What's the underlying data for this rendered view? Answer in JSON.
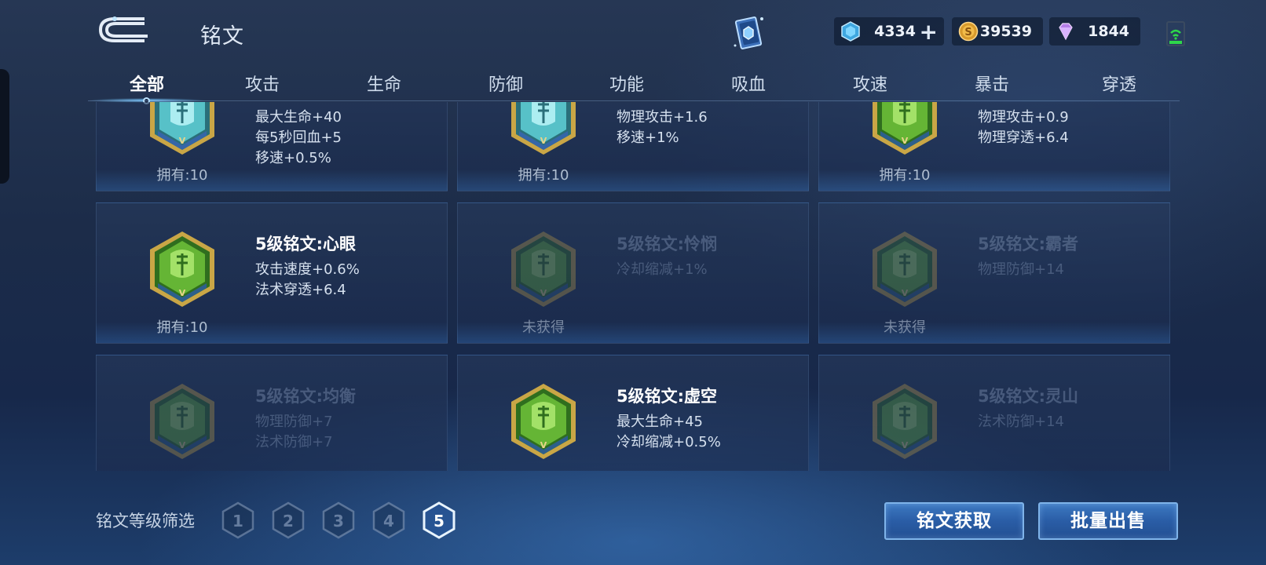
{
  "header": {
    "title": "铭文",
    "currencies": {
      "gem": {
        "value": "4334",
        "plus": "+"
      },
      "gold": {
        "value": "39539"
      },
      "diamond": {
        "value": "1844"
      }
    }
  },
  "tabs": [
    "全部",
    "攻击",
    "生命",
    "防御",
    "功能",
    "吸血",
    "攻速",
    "暴击",
    "穿透"
  ],
  "active_tab": "全部",
  "cards": [
    {
      "name": "",
      "stats": [
        "最大生命+40",
        "每5秒回血+5",
        "移速+0.5%"
      ],
      "owned": "拥有:10",
      "locked": false,
      "color": "teal"
    },
    {
      "name": "",
      "stats": [
        "物理攻击+1.6",
        "移速+1%"
      ],
      "owned": "拥有:10",
      "locked": false,
      "color": "teal"
    },
    {
      "name": "",
      "stats": [
        "物理攻击+0.9",
        "物理穿透+6.4"
      ],
      "owned": "拥有:10",
      "locked": false,
      "color": "green"
    },
    {
      "name": "5级铭文:心眼",
      "stats": [
        "攻击速度+0.6%",
        "法术穿透+6.4"
      ],
      "owned": "拥有:10",
      "locked": false,
      "color": "green"
    },
    {
      "name": "5级铭文:怜悯",
      "stats": [
        "冷却缩减+1%"
      ],
      "owned": "未获得",
      "locked": true,
      "color": "green"
    },
    {
      "name": "5级铭文:霸者",
      "stats": [
        "物理防御+14"
      ],
      "owned": "未获得",
      "locked": true,
      "color": "green"
    },
    {
      "name": "5级铭文:均衡",
      "stats": [
        "物理防御+7",
        "法术防御+7"
      ],
      "owned": "",
      "locked": true,
      "color": "green"
    },
    {
      "name": "5级铭文:虚空",
      "stats": [
        "最大生命+45",
        "冷却缩减+0.5%"
      ],
      "owned": "",
      "locked": false,
      "color": "green"
    },
    {
      "name": "5级铭文:灵山",
      "stats": [
        "法术防御+14"
      ],
      "owned": "",
      "locked": true,
      "color": "green"
    }
  ],
  "filter": {
    "label": "铭文等级筛选",
    "levels": [
      "1",
      "2",
      "3",
      "4",
      "5"
    ],
    "selected": "5"
  },
  "buttons": {
    "acquire": "铭文获取",
    "sell": "批量出售"
  },
  "colors": {
    "accent": "#7fb4ea",
    "emblem_green": "#5fae2e",
    "emblem_teal": "#5fd0d6",
    "emblem_gold": "#d9b24a"
  }
}
